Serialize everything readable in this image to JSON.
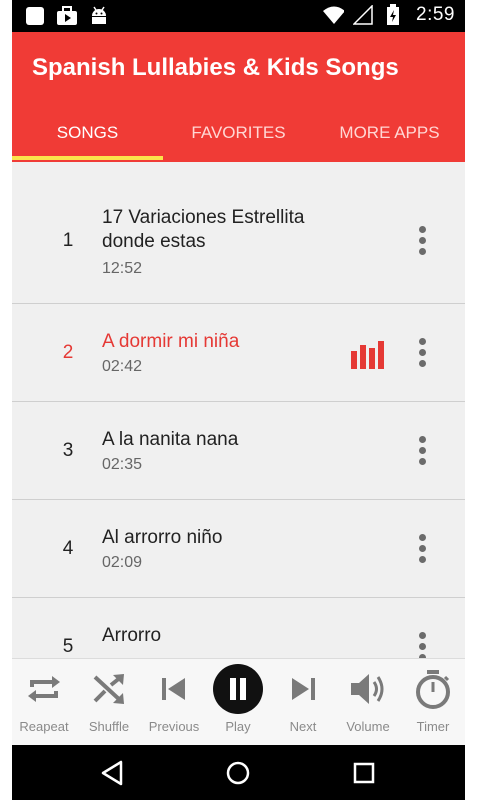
{
  "status_bar": {
    "time": "2:59"
  },
  "app": {
    "title": "Spanish Lullabies & Kids Songs"
  },
  "tabs": [
    {
      "label": "SONGS",
      "active": true
    },
    {
      "label": "FAVORITES",
      "active": false
    },
    {
      "label": "MORE APPS",
      "active": false
    }
  ],
  "songs": [
    {
      "number": "1",
      "title": "17 Variaciones Estrellita donde estas",
      "duration": "12:52",
      "playing": false
    },
    {
      "number": "2",
      "title": "A dormir mi niña",
      "duration": "02:42",
      "playing": true
    },
    {
      "number": "3",
      "title": "A la nanita nana",
      "duration": "02:35",
      "playing": false
    },
    {
      "number": "4",
      "title": "Al arrorro niño",
      "duration": "02:09",
      "playing": false
    },
    {
      "number": "5",
      "title": "Arrorro",
      "duration": "",
      "playing": false
    }
  ],
  "player": {
    "repeat": "Reapeat",
    "shuffle": "Shuffle",
    "previous": "Previous",
    "play": "Play",
    "next": "Next",
    "volume": "Volume",
    "timer": "Timer"
  },
  "colors": {
    "accent": "#f03b36",
    "tab_indicator": "#fbe44b",
    "playing_text": "#e53935"
  }
}
